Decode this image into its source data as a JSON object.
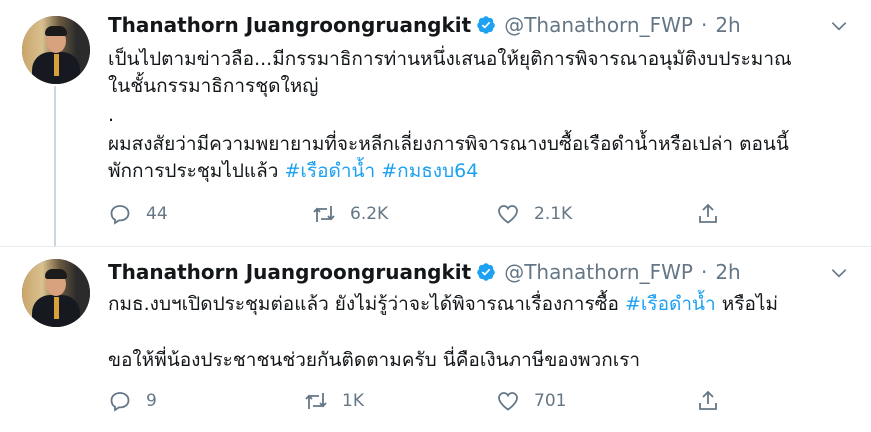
{
  "tweets": [
    {
      "name": "Thanathorn Juangroongruangkit",
      "handle": "@Thanathorn_FWP",
      "dot": "·",
      "time": "2h",
      "line1": "เป็นไปตามข่าวลือ...มีกรรมาธิการท่านหนึ่งเสนอให้ยุติการพิจารณาอนุมัติงบประมาณ",
      "line2": "ในชั้นกรรมาธิการชุดใหญ่",
      "line3": ".",
      "line4": "ผมสงสัยว่ามีความพยายามที่จะหลีกเลี่ยงการพิจารณางบซื้อเรือดำน้ำหรือเปล่า ตอนนี้",
      "line5_text": "พักการประชุมไปแล้ว ",
      "hashtag1": "#เรือดำน้ำ",
      "hashtag2": "#กมธงบ64",
      "replies": "44",
      "retweets": "6.2K",
      "likes": "2.1K"
    },
    {
      "name": "Thanathorn Juangroongruangkit",
      "handle": "@Thanathorn_FWP",
      "dot": "·",
      "time": "2h",
      "line1_pre": "กมธ.งบฯเปิดประชุมต่อแล้ว ยังไม่รู้ว่าจะได้พิจารณาเรื่องการซื้อ ",
      "hashtag1": "#เรือดำน้ำ",
      "line1_post": " หรือไม่",
      "line2": "ขอให้พี่น้องประชาชนช่วยกันติดตามครับ นี่คือเงินภาษีของพวกเรา",
      "replies": "9",
      "retweets": "1K",
      "likes": "701"
    }
  ],
  "colors": {
    "accent": "#1da1f2",
    "secondary": "#657786",
    "text": "#14171a"
  },
  "icons": [
    "verified-badge-icon",
    "chevron-down-icon",
    "reply-icon",
    "retweet-icon",
    "like-icon",
    "share-icon"
  ]
}
